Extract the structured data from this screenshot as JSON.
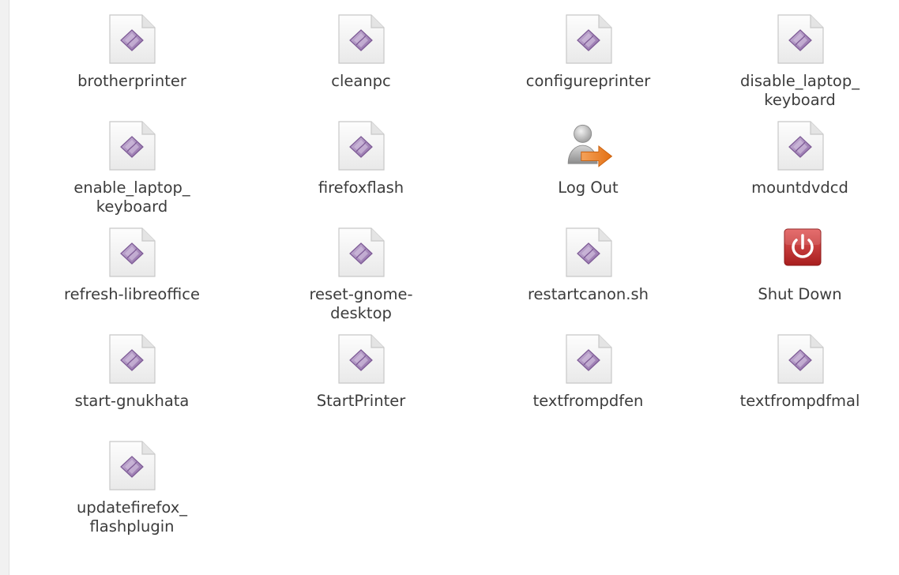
{
  "files": [
    {
      "label": "brotherprinter",
      "icon": "script-file-icon"
    },
    {
      "label": "cleanpc",
      "icon": "script-file-icon"
    },
    {
      "label": "configureprinter",
      "icon": "script-file-icon"
    },
    {
      "label": "disable_laptop_\nkeyboard",
      "icon": "script-file-icon"
    },
    {
      "label": "enable_laptop_\nkeyboard",
      "icon": "script-file-icon"
    },
    {
      "label": "firefoxflash",
      "icon": "script-file-icon"
    },
    {
      "label": "Log Out",
      "icon": "log-out-icon"
    },
    {
      "label": "mountdvdcd",
      "icon": "script-file-icon"
    },
    {
      "label": "refresh-libreoffice",
      "icon": "script-file-icon"
    },
    {
      "label": "reset-gnome-\ndesktop",
      "icon": "script-file-icon"
    },
    {
      "label": "restartcanon.sh",
      "icon": "script-file-icon"
    },
    {
      "label": "Shut Down",
      "icon": "shut-down-icon"
    },
    {
      "label": "start-gnukhata",
      "icon": "script-file-icon"
    },
    {
      "label": "StartPrinter",
      "icon": "script-file-icon"
    },
    {
      "label": "textfrompdfen",
      "icon": "script-file-icon"
    },
    {
      "label": "textfrompdfmal",
      "icon": "script-file-icon"
    },
    {
      "label": "updatefirefox_\nflashplugin",
      "icon": "script-file-icon"
    }
  ],
  "colors": {
    "label_text": "#3c3c3c",
    "file_diamond": "#a487b8",
    "shutdown_red": "#c72c2c",
    "logout_arrow": "#e87722"
  }
}
